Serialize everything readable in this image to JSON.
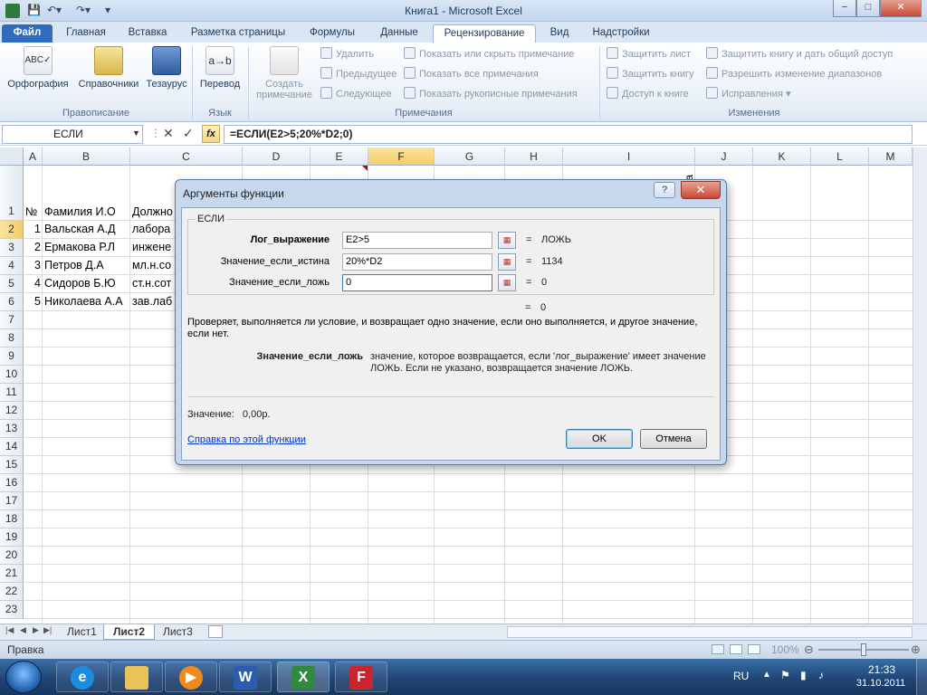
{
  "window": {
    "title": "Книга1 - Microsoft Excel",
    "min": "−",
    "max": "□",
    "close": "✕"
  },
  "tabs": [
    {
      "label": "Файл"
    },
    {
      "label": "Главная"
    },
    {
      "label": "Вставка"
    },
    {
      "label": "Разметка страницы"
    },
    {
      "label": "Формулы"
    },
    {
      "label": "Данные"
    },
    {
      "label": "Рецензирование"
    },
    {
      "label": "Вид"
    },
    {
      "label": "Надстройки"
    }
  ],
  "ribbon": {
    "proofing": {
      "label": "Правописание",
      "spelling": "Орфография",
      "research": "Справочники",
      "thesaurus": "Тезаурус"
    },
    "language": {
      "label": "Язык",
      "translate": "Перевод"
    },
    "comments": {
      "label": "Примечания",
      "new_comment_1": "Создать",
      "new_comment_2": "примечание",
      "delete": "Удалить",
      "previous": "Предыдущее",
      "next": "Следующее",
      "show_hide": "Показать или скрыть примечание",
      "show_all": "Показать все примечания",
      "show_ink": "Показать рукописные примечания"
    },
    "changes": {
      "label": "Изменения",
      "protect_sheet": "Защитить лист",
      "protect_book": "Защитить книгу",
      "share_book": "Доступ к книге",
      "protect_share": "Защитить книгу и дать общий доступ",
      "allow_ranges": "Разрешить изменение диапазонов",
      "track": "Исправления ▾"
    }
  },
  "formula_bar": {
    "name_box": "ЕСЛИ",
    "fx": "fx",
    "formula": "=ЕСЛИ(E2>5;20%*D2;0)"
  },
  "grid": {
    "columns": [
      "A",
      "B",
      "C",
      "D",
      "E",
      "F",
      "G",
      "H",
      "I",
      "J",
      "K",
      "L",
      "M"
    ],
    "rows": [
      "1",
      "2",
      "3",
      "4",
      "5",
      "6",
      "7",
      "8",
      "9",
      "10",
      "11",
      "12",
      "13",
      "14",
      "15",
      "16",
      "17",
      "18",
      "19",
      "20",
      "21",
      "22",
      "23"
    ],
    "header_row": {
      "a": "№",
      "b": "Фамилия И.О",
      "c": "Должно"
    },
    "rotated_i": "та",
    "data": [
      {
        "n": "1",
        "name": "Вальская А.Д",
        "pos": "лабора"
      },
      {
        "n": "2",
        "name": "Ермакова Р.Л",
        "pos": "инжене"
      },
      {
        "n": "3",
        "name": "Петров Д.А",
        "pos": "мл.н.со"
      },
      {
        "n": "4",
        "name": "Сидоров Б.Ю",
        "pos": "ст.н.сот"
      },
      {
        "n": "5",
        "name": "Николаева А.А",
        "pos": "зав.лаб"
      }
    ]
  },
  "sheets": [
    {
      "label": "Лист1"
    },
    {
      "label": "Лист2"
    },
    {
      "label": "Лист3"
    }
  ],
  "status": {
    "mode": "Правка",
    "zoom": "100%"
  },
  "taskbar": {
    "lang": "RU",
    "time": "21:33",
    "date": "31.10.2011"
  },
  "dialog": {
    "title": "Аргументы функции",
    "help": "?",
    "close": "✕",
    "function": "ЕСЛИ",
    "args": [
      {
        "name": "Лог_выражение",
        "value": "E2>5",
        "eq": "=",
        "result": "ЛОЖЬ"
      },
      {
        "name": "Значение_если_истина",
        "value": "20%*D2",
        "eq": "=",
        "result": "1134"
      },
      {
        "name": "Значение_если_ложь",
        "value": "0",
        "eq": "=",
        "result": "0"
      }
    ],
    "total_eq": "=",
    "total_result": "0",
    "description": "Проверяет, выполняется ли условие, и возвращает одно значение, если оно выполняется, и другое значение, если нет.",
    "arg_desc_name": "Значение_если_ложь",
    "arg_desc_text": "значение, которое возвращается, если 'лог_выражение' имеет значение ЛОЖЬ. Если не указано, возвращается значение ЛОЖЬ.",
    "value_label": "Значение:",
    "value": "0,00р.",
    "help_link": "Справка по этой функции",
    "ok": "OK",
    "cancel": "Отмена"
  }
}
